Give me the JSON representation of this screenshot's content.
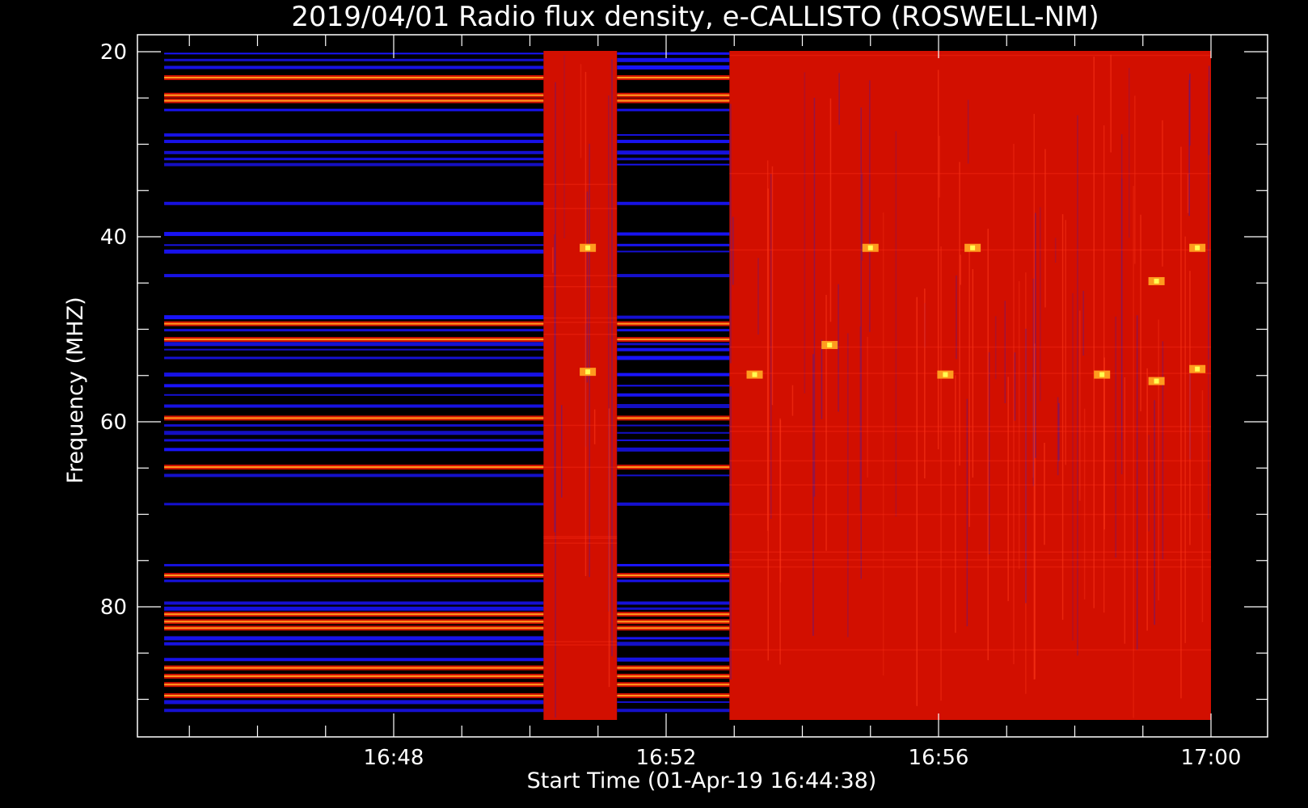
{
  "chart_data": {
    "type": "heatmap",
    "title": "2019/04/01  Radio flux density, e-CALLISTO (ROSWELL-NM)",
    "xlabel": "Start Time (01-Apr-19 16:44:38)",
    "ylabel": "Frequency (MHZ)",
    "x_ticks": [
      "16:48",
      "16:52",
      "16:56",
      "17:00"
    ],
    "x_tick_minutes": [
      48,
      52,
      56,
      60
    ],
    "y_ticks": [
      20,
      40,
      60,
      80
    ],
    "y_range_mhz": [
      20,
      92
    ],
    "x_range_minutes": [
      44.63,
      60
    ],
    "colors": {
      "background": "#000000",
      "low": "#1a14ff",
      "mid": "#d20f00",
      "high": "#ff9b1e",
      "peak": "#ffff50"
    },
    "segments": [
      {
        "start_min": 44.63,
        "end_min": 50.2,
        "level": "low"
      },
      {
        "start_min": 50.2,
        "end_min": 51.28,
        "level": "high"
      },
      {
        "start_min": 51.28,
        "end_min": 52.93,
        "level": "low"
      },
      {
        "start_min": 52.93,
        "end_min": 60.0,
        "level": "high"
      }
    ],
    "bright_bands_mhz": [
      22.8,
      24.7,
      25.3,
      49.4,
      51.1,
      59.6,
      64.9,
      76.6,
      80.8,
      81.6,
      82.3,
      86.6,
      87.5,
      88.4,
      89.6
    ],
    "blue_bands_mhz": [
      20.2,
      20.9,
      21.7,
      26.3,
      29.0,
      29.7,
      30.9,
      31.6,
      32.2,
      36.4,
      39.7,
      40.9,
      41.6,
      44.2,
      48.7,
      50.1,
      51.6,
      52.2,
      53.1,
      54.9,
      56.1,
      57.1,
      58.3,
      60.4,
      61.2,
      62.0,
      63.0,
      65.8,
      68.9,
      75.5,
      77.2,
      79.6,
      80.2,
      83.4,
      84.0,
      85.7,
      90.3,
      91.2
    ],
    "hot_spots": [
      {
        "time_min": 50.85,
        "freq_mhz": 41.2
      },
      {
        "time_min": 50.85,
        "freq_mhz": 54.6
      },
      {
        "time_min": 53.3,
        "freq_mhz": 54.9
      },
      {
        "time_min": 54.4,
        "freq_mhz": 51.7
      },
      {
        "time_min": 55.0,
        "freq_mhz": 41.2
      },
      {
        "time_min": 56.1,
        "freq_mhz": 54.9
      },
      {
        "time_min": 56.5,
        "freq_mhz": 41.2
      },
      {
        "time_min": 58.4,
        "freq_mhz": 54.9
      },
      {
        "time_min": 59.2,
        "freq_mhz": 44.8
      },
      {
        "time_min": 59.2,
        "freq_mhz": 55.6
      },
      {
        "time_min": 59.8,
        "freq_mhz": 41.2
      },
      {
        "time_min": 59.8,
        "freq_mhz": 54.3
      }
    ]
  }
}
